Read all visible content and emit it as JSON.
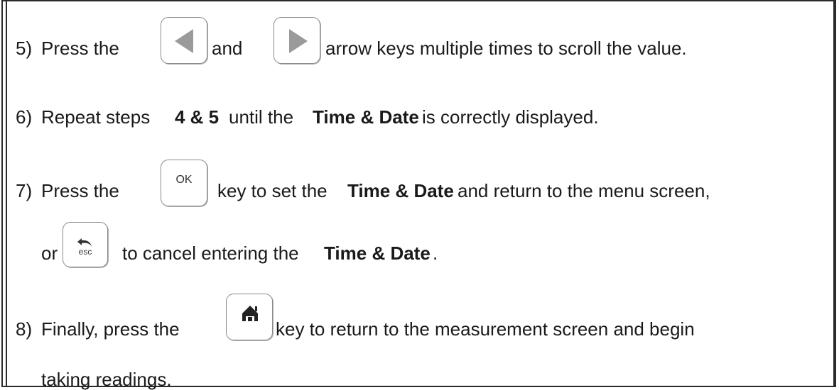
{
  "steps": [
    {
      "number": "5)",
      "parts": [
        "Press the",
        "and",
        "arrow keys multiple times to scroll the value."
      ],
      "keys": [
        "left-arrow-key",
        "right-arrow-key"
      ]
    },
    {
      "number": "6)",
      "parts": [
        "Repeat steps",
        "4 & 5",
        "until the",
        "Time & Date",
        "is correctly displayed."
      ]
    },
    {
      "number": "7)",
      "parts": [
        "Press the",
        "key to set the",
        "Time & Date",
        "and return to the menu screen,"
      ],
      "line2": [
        "or",
        "to cancel entering the",
        "Time & Date",
        "."
      ],
      "keys": [
        "ok-key",
        "esc-key"
      ]
    },
    {
      "number": "8)",
      "parts": [
        "Finally, press the",
        "key to return to the measurement screen and begin"
      ],
      "line2": [
        "taking readings."
      ],
      "keys": [
        "home-key"
      ]
    }
  ],
  "key_labels": {
    "ok": "OK",
    "esc": "esc"
  },
  "colors": {
    "key_border": "#8a8a8a",
    "key_icon": "#9a9a9a",
    "home_icon": "#222222",
    "frame": "#2a2a2a"
  }
}
